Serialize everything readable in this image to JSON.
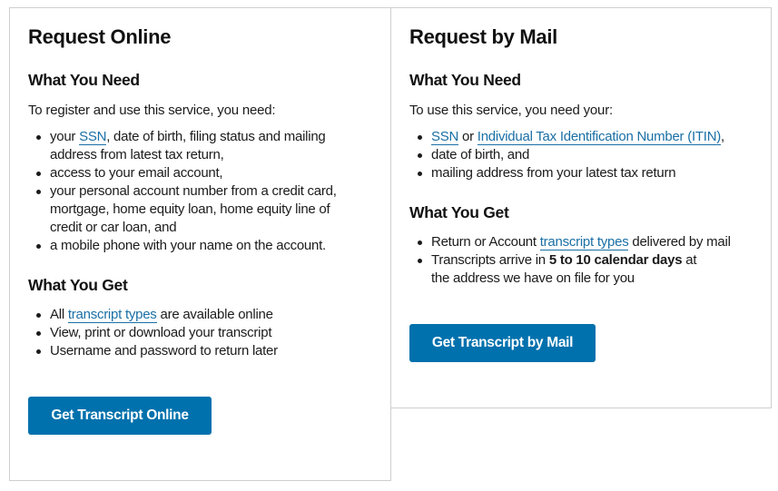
{
  "online": {
    "title": "Request Online",
    "need_heading": "What You Need",
    "intro": "To register and use this service, you need:",
    "need_items": [
      {
        "pre": "your ",
        "link": "SSN",
        "post": ", date of birth, filing status and mailing address from latest tax return,"
      },
      {
        "text": "access to your email account,"
      },
      {
        "text": "your personal account number from a credit card, mortgage, home equity loan, home equity line of credit or car loan, and"
      },
      {
        "text": "a mobile phone with your name on the account."
      }
    ],
    "get_heading": "What You Get",
    "get_items": [
      {
        "pre": "All ",
        "link": "transcript types",
        "post": " are available online"
      },
      {
        "text": "View, print or download your transcript"
      },
      {
        "text": "Username and password to return later"
      }
    ],
    "button_label": "Get Transcript Online"
  },
  "mail": {
    "title": "Request by Mail",
    "need_heading": "What You Need",
    "intro": "To use this service, you need your:",
    "need_items": [
      {
        "link1": "SSN",
        "mid": " or ",
        "link2": "Individual Tax Identification Number (ITIN)",
        "post": ","
      },
      {
        "text": "date of birth, and"
      },
      {
        "text": "mailing address from your latest tax return"
      }
    ],
    "get_heading": "What You Get",
    "get_items": [
      {
        "pre": "Return or Account ",
        "link": "transcript types",
        "post": " delivered by mail"
      },
      {
        "pre": "Transcripts arrive in ",
        "bold": "5 to 10 calendar days",
        "post": " at the address we have on file for you"
      }
    ],
    "button_label": "Get Transcript by Mail"
  },
  "colors": {
    "button_bg": "#0071ad",
    "button_text": "#ffffff",
    "link": "#1a6fa5",
    "border": "#cfcfcf",
    "text": "#1b1b1b"
  }
}
